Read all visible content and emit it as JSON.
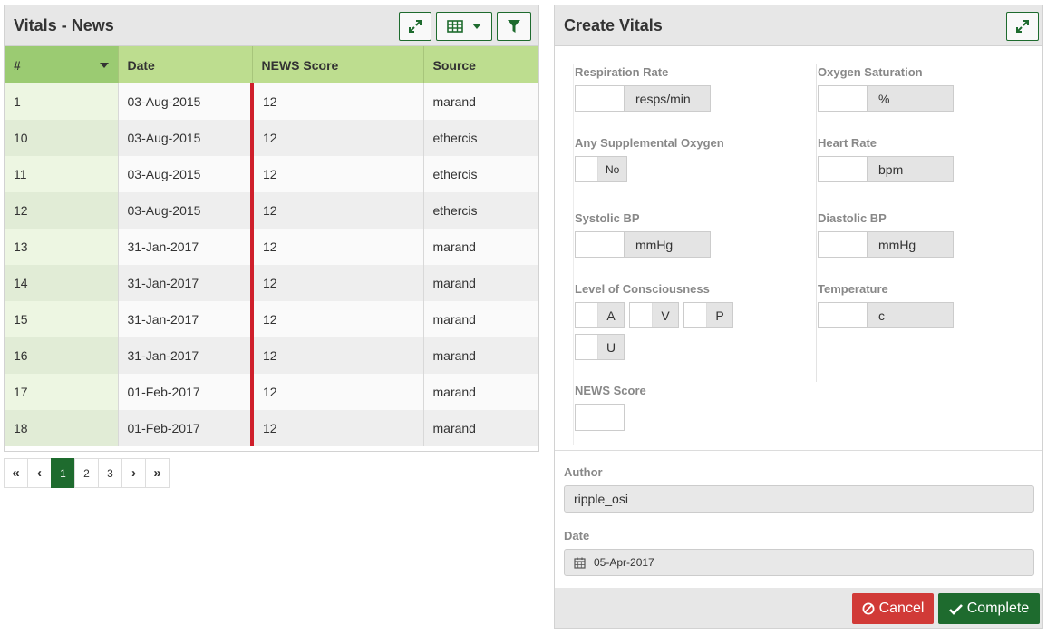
{
  "left": {
    "title": "Vitals - News",
    "columns": [
      "#",
      "Date",
      "NEWS Score",
      "Source"
    ],
    "rows": [
      {
        "num": "1",
        "date": "03-Aug-2015",
        "score": "12",
        "source": "marand"
      },
      {
        "num": "10",
        "date": "03-Aug-2015",
        "score": "12",
        "source": "ethercis"
      },
      {
        "num": "11",
        "date": "03-Aug-2015",
        "score": "12",
        "source": "ethercis"
      },
      {
        "num": "12",
        "date": "03-Aug-2015",
        "score": "12",
        "source": "ethercis"
      },
      {
        "num": "13",
        "date": "31-Jan-2017",
        "score": "12",
        "source": "marand"
      },
      {
        "num": "14",
        "date": "31-Jan-2017",
        "score": "12",
        "source": "marand"
      },
      {
        "num": "15",
        "date": "31-Jan-2017",
        "score": "12",
        "source": "marand"
      },
      {
        "num": "16",
        "date": "31-Jan-2017",
        "score": "12",
        "source": "marand"
      },
      {
        "num": "17",
        "date": "01-Feb-2017",
        "score": "12",
        "source": "marand"
      },
      {
        "num": "18",
        "date": "01-Feb-2017",
        "score": "12",
        "source": "marand"
      }
    ],
    "pager": {
      "first": "«",
      "prev": "‹",
      "pages": [
        "1",
        "2",
        "3"
      ],
      "next": "›",
      "last": "»",
      "active": "1"
    },
    "icons": {
      "expand": "expand-icon",
      "table": "table-icon",
      "dropdown": "caret-down-icon",
      "filter": "filter-icon"
    }
  },
  "right": {
    "title": "Create Vitals",
    "fields": {
      "respiration_rate": {
        "label": "Respiration Rate",
        "unit": "resps/min",
        "value": ""
      },
      "oxygen_saturation": {
        "label": "Oxygen Saturation",
        "unit": "%",
        "value": ""
      },
      "supplemental_oxygen": {
        "label": "Any Supplemental Oxygen",
        "toggle": "No"
      },
      "heart_rate": {
        "label": "Heart Rate",
        "unit": "bpm",
        "value": ""
      },
      "systolic_bp": {
        "label": "Systolic BP",
        "unit": "mmHg",
        "value": ""
      },
      "diastolic_bp": {
        "label": "Diastolic BP",
        "unit": "mmHg",
        "value": ""
      },
      "consciousness": {
        "label": "Level of Consciousness",
        "options": [
          "A",
          "V",
          "P",
          "U"
        ]
      },
      "temperature": {
        "label": "Temperature",
        "unit": "c",
        "value": ""
      },
      "news_score": {
        "label": "NEWS Score",
        "value": ""
      }
    },
    "author": {
      "label": "Author",
      "value": "ripple_osi"
    },
    "date": {
      "label": "Date",
      "value": "05-Apr-2017"
    },
    "buttons": {
      "cancel": "Cancel",
      "complete": "Complete"
    }
  },
  "colors": {
    "accent": "#1e6b2e",
    "header_green": "#bddd8f",
    "danger": "#d13a37",
    "score_bar": "#cf1f2b"
  }
}
